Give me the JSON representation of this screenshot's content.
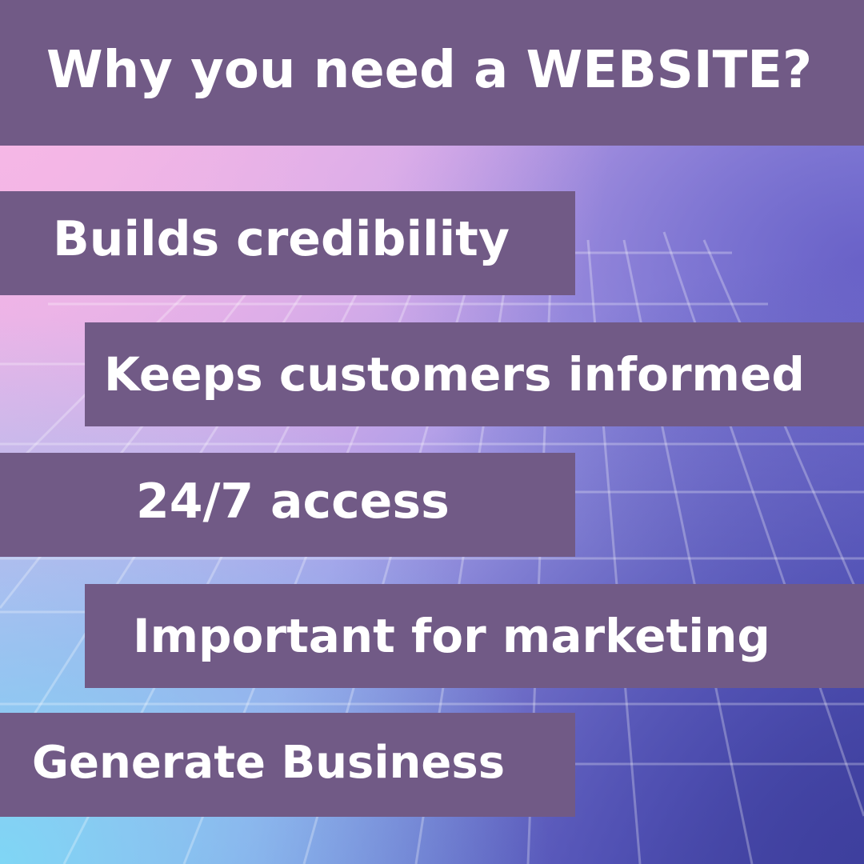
{
  "title": "Why you need a WEBSITE?",
  "items": [
    {
      "label": "Builds credibility"
    },
    {
      "label": "Keeps customers informed"
    },
    {
      "label": "24/7 access"
    },
    {
      "label": "Important for marketing"
    },
    {
      "label": "Generate Business"
    }
  ],
  "colors": {
    "band": "#715a86",
    "text": "#ffffff",
    "background_pink": "#f2b9e6",
    "background_cyan": "#7fd6f5",
    "background_violet": "#4a4aa8"
  }
}
